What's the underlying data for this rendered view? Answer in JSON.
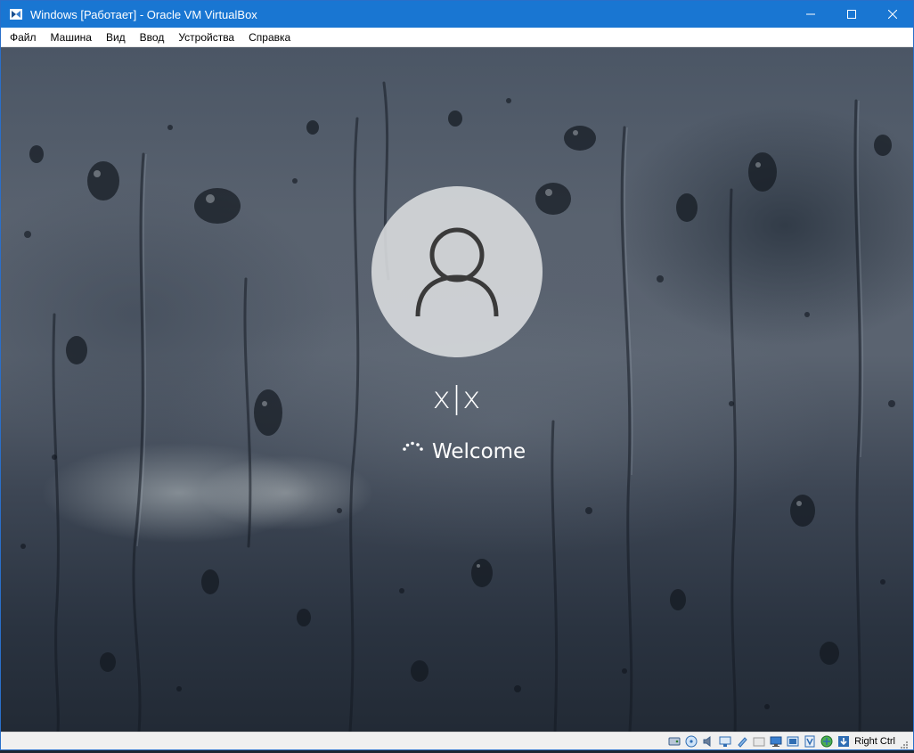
{
  "window": {
    "title": "Windows [Работает] - Oracle VM VirtualBox",
    "titlebar_color": "#1976d2",
    "controls": [
      "minimize-icon",
      "maximize-icon",
      "close-icon"
    ]
  },
  "menu": {
    "items": [
      "Файл",
      "Машина",
      "Вид",
      "Ввод",
      "Устройства",
      "Справка"
    ]
  },
  "login_screen": {
    "avatar_icon": "user-icon",
    "username": "x|x",
    "status": "Welcome",
    "spinner_icon": "loading-spinner-icon"
  },
  "statusbar": {
    "icons": [
      "hard-disk-icon",
      "optical-drive-icon",
      "audio-icon",
      "network-icon",
      "usb-icon",
      "shared-folders-icon",
      "display-icon",
      "video-capture-icon",
      "cpu-icon",
      "mouse-integration-icon",
      "keyboard-capture-icon"
    ],
    "host_key": "Right Ctrl"
  }
}
